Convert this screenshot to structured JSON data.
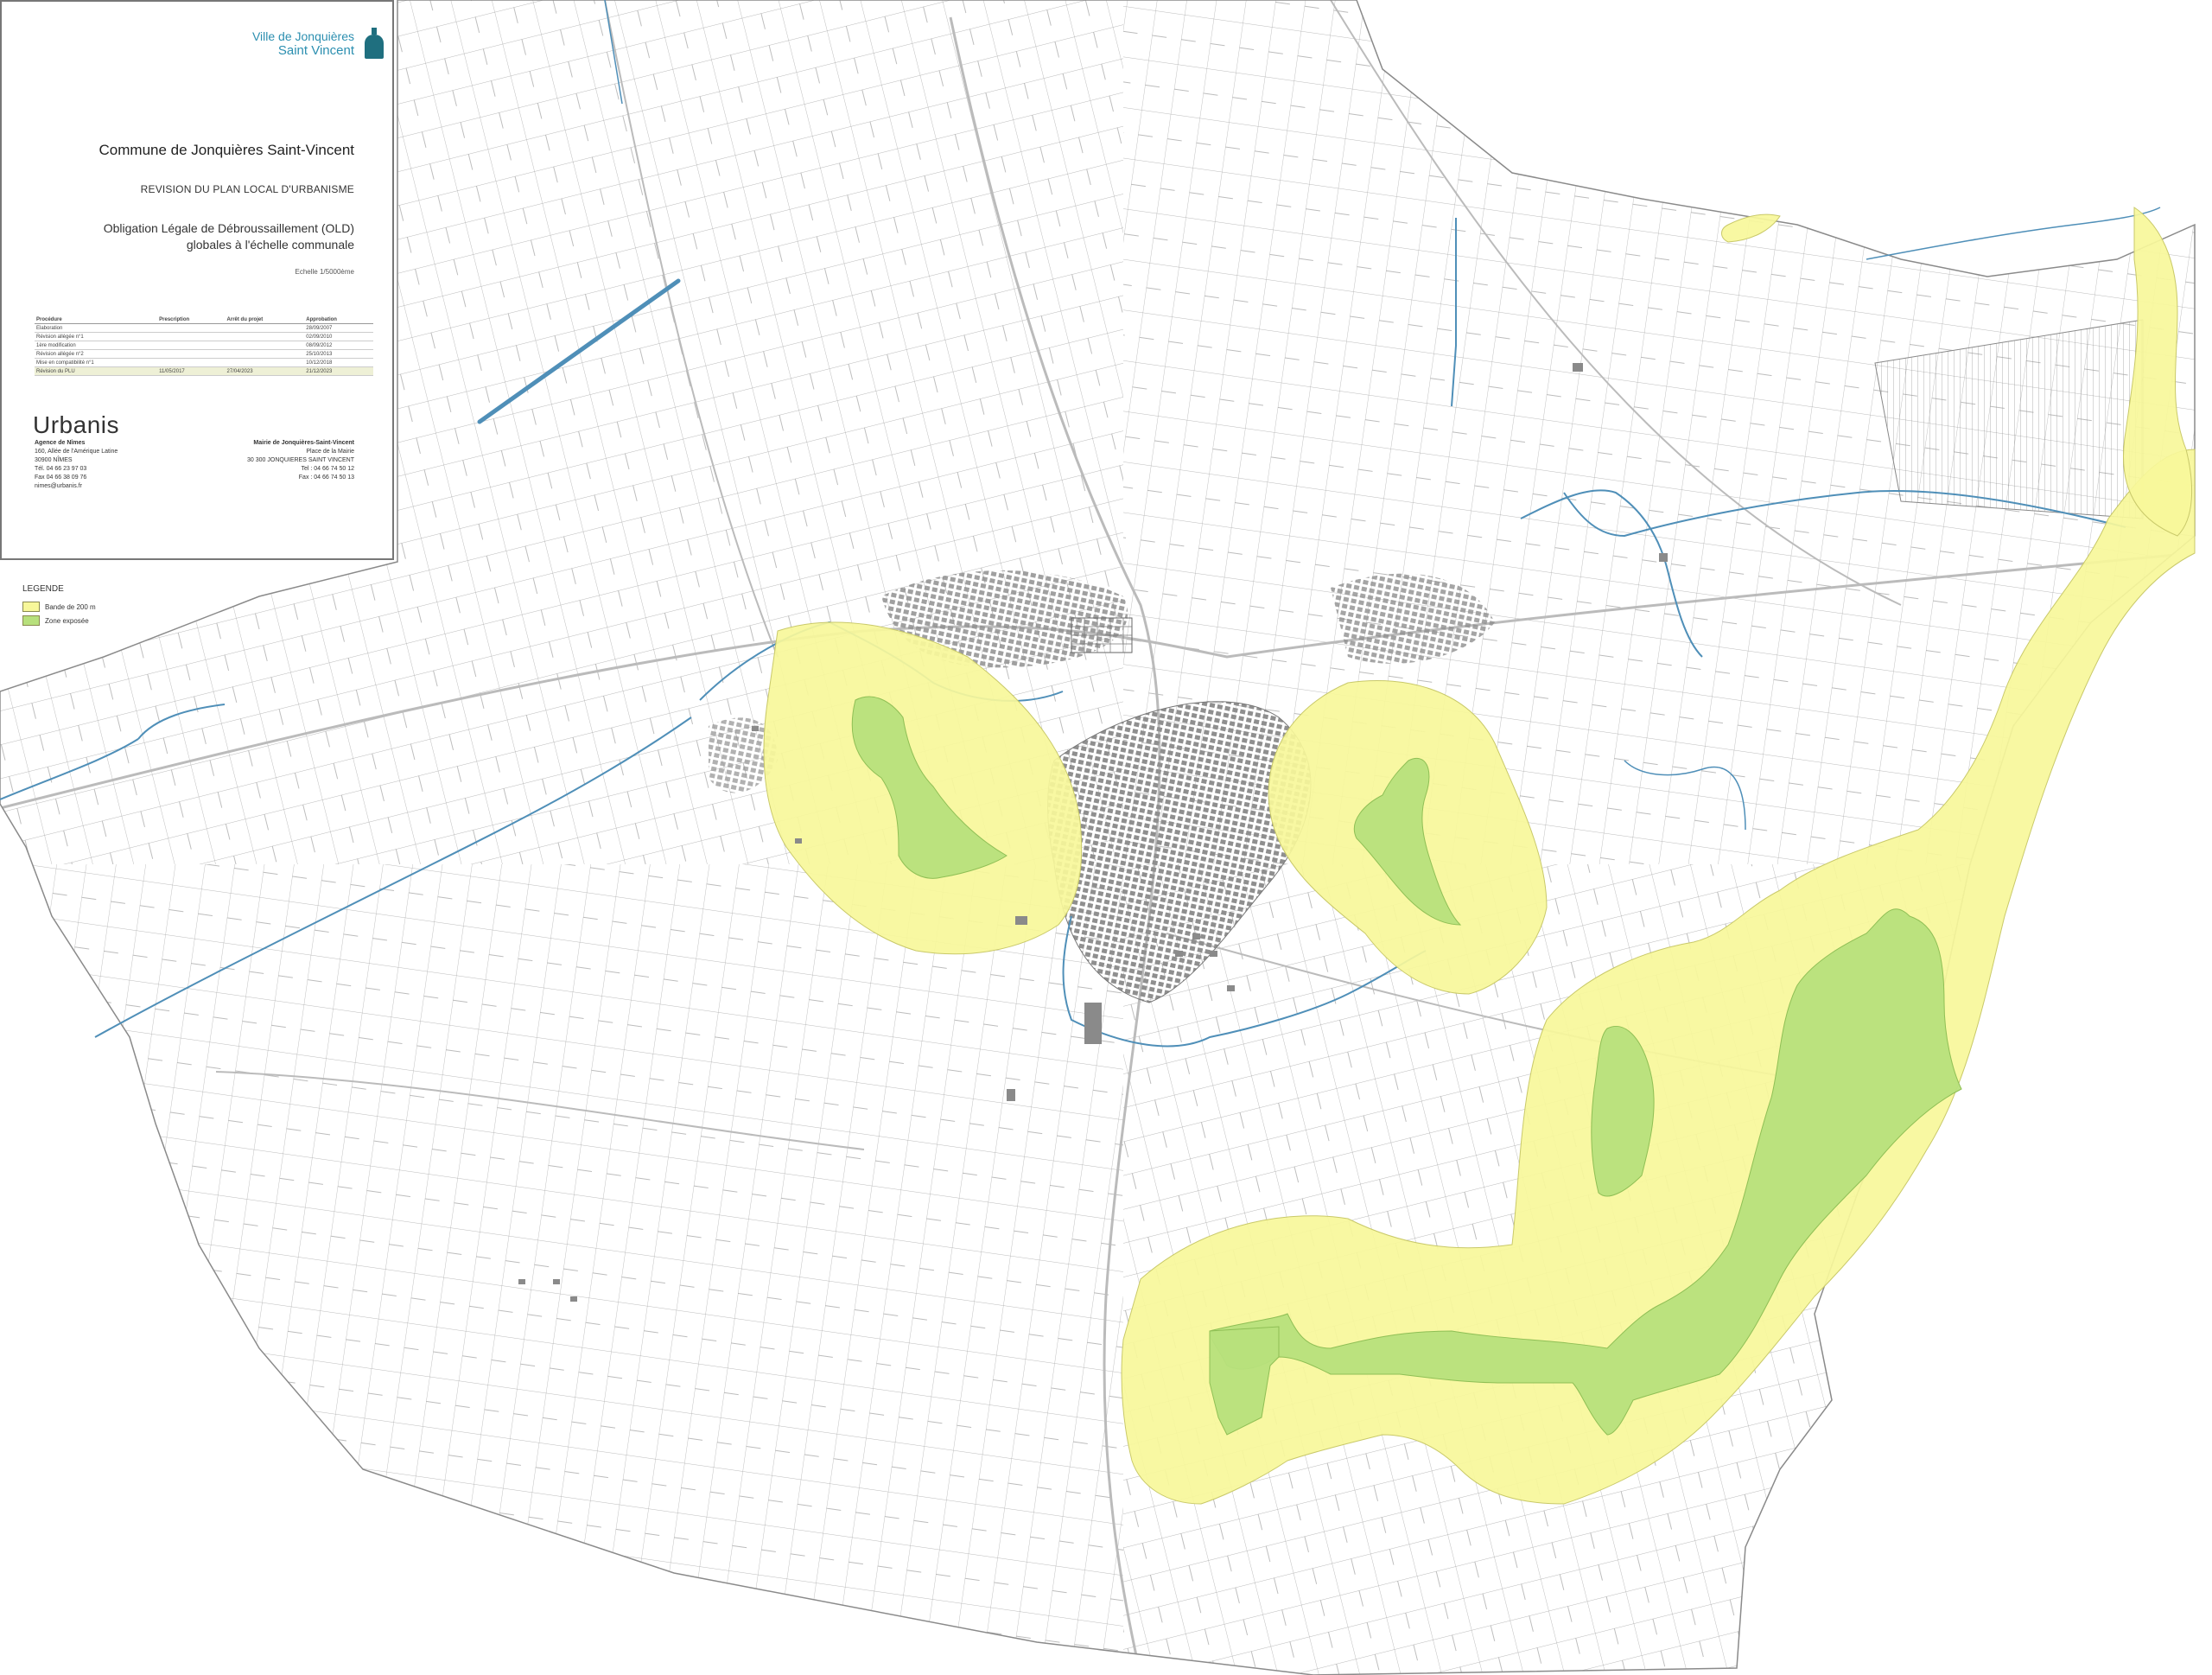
{
  "header": {
    "logo_line1": "Ville de Jonquières",
    "logo_line2": "Saint Vincent",
    "commune": "Commune de Jonquières Saint-Vincent",
    "revision": "REVISION DU PLAN LOCAL D'URBANISME",
    "old_line1": "Obligation Légale de Débroussaillement (OLD)",
    "old_line2": "globales à l'échelle communale",
    "scale": "Echelle 1/5000ème"
  },
  "procedure_table": {
    "columns": [
      "Procédure",
      "Prescription",
      "Arrêt du projet",
      "Approbation"
    ],
    "rows": [
      [
        "Elaboration",
        "",
        "",
        "28/09/2007"
      ],
      [
        "Révision allégée n°1",
        "",
        "",
        "02/09/2010"
      ],
      [
        "1ère modification",
        "",
        "",
        "08/09/2012"
      ],
      [
        "Révision allégée n°2",
        "",
        "",
        "25/10/2013"
      ],
      [
        "Mise en compatibilité n°1",
        "",
        "",
        "10/12/2018"
      ],
      [
        "Révision du PLU",
        "11/05/2017",
        "27/04/2023",
        "21/12/2023"
      ]
    ]
  },
  "urbanis": {
    "brand": "Urbanis",
    "agency": "Agence de Nîmes",
    "address": "160, Allée de l'Amérique Latine",
    "city": "30900 NÎMES",
    "tel": "Tél. 04 66 23 97 03",
    "fax": "Fax 04 66 38 09 76",
    "email": "nimes@urbanis.fr"
  },
  "mairie": {
    "name": "Mairie de Jonquières-Saint-Vincent",
    "address": "Place de la Mairie",
    "city": "30 300 JONQUIERES SAINT VINCENT",
    "tel": "Tel : 04 66 74 50 12",
    "fax": "Fax : 04 66 74 50 13"
  },
  "legend": {
    "title": "LEGENDE",
    "items": [
      {
        "label": "Bande de 200 m",
        "color": "#f7f79a"
      },
      {
        "label": "Zone exposée",
        "color": "#b7e07c"
      }
    ]
  },
  "colors": {
    "band": "#f7f79a",
    "band_stroke": "#c9c96a",
    "exposed": "#b7e07c",
    "exposed_stroke": "#8fbf55",
    "parcel_lines": "#9a9a9a",
    "water": "#4f8fb8",
    "buildings": "#8a8a8a"
  }
}
